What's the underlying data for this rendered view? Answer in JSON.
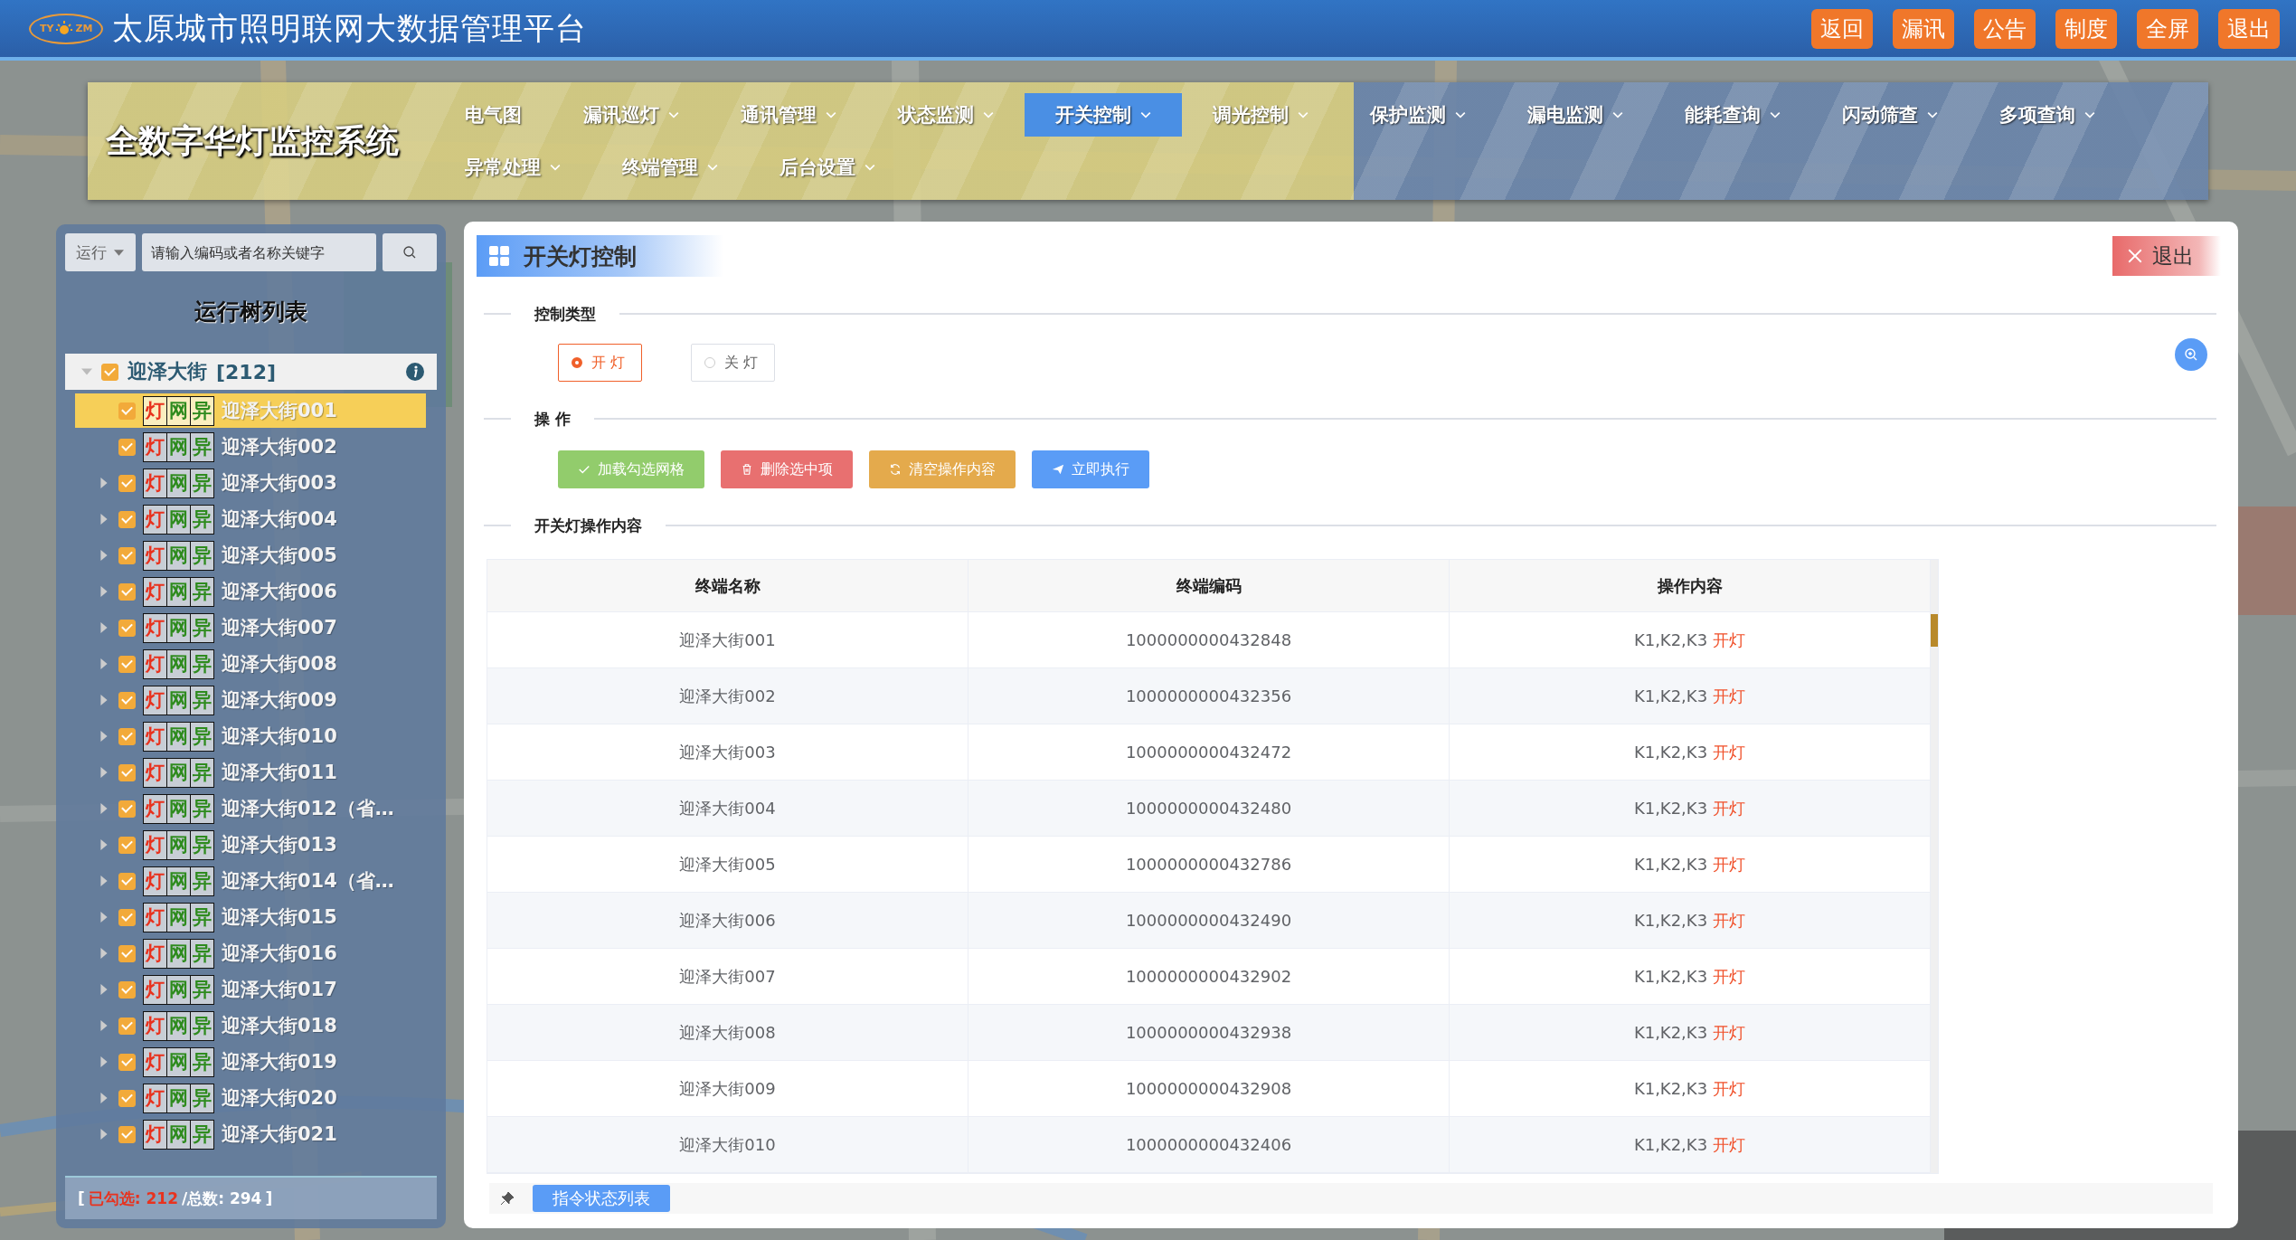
{
  "header": {
    "logo": {
      "left": "TY",
      "right": "ZM"
    },
    "title": "太原城市照明联网大数据管理平台",
    "buttons": [
      "返回",
      "漏讯",
      "公告",
      "制度",
      "全屏",
      "退出"
    ]
  },
  "nav": {
    "title": "全数字华灯监控系统",
    "rows": [
      [
        {
          "label": "电气图",
          "has_menu": false,
          "selected": false
        },
        {
          "label": "漏讯巡灯",
          "has_menu": true,
          "selected": false
        },
        {
          "label": "通讯管理",
          "has_menu": true,
          "selected": false
        },
        {
          "label": "状态监测",
          "has_menu": true,
          "selected": false
        },
        {
          "label": "开关控制",
          "has_menu": true,
          "selected": true
        },
        {
          "label": "调光控制",
          "has_menu": true,
          "selected": false
        },
        {
          "label": "保护监测",
          "has_menu": true,
          "selected": false
        },
        {
          "label": "漏电监测",
          "has_menu": true,
          "selected": false
        },
        {
          "label": "能耗查询",
          "has_menu": true,
          "selected": false
        },
        {
          "label": "闪动筛查",
          "has_menu": true,
          "selected": false
        },
        {
          "label": "多项查询",
          "has_menu": true,
          "selected": false
        }
      ],
      [
        {
          "label": "异常处理",
          "has_menu": true,
          "selected": false
        },
        {
          "label": "终端管理",
          "has_menu": true,
          "selected": false
        },
        {
          "label": "后台设置",
          "has_menu": true,
          "selected": false
        }
      ]
    ]
  },
  "sidebar": {
    "filter": "运行",
    "search": {
      "placeholder": "请输入编码或者名称关键字"
    },
    "title": "运行树列表",
    "tree": {
      "label": "迎泽大街",
      "count": "[212]",
      "checked": true,
      "expanded": true,
      "children": [
        {
          "label": "迎泽大街001",
          "checked": true,
          "selected": true,
          "expandable": false,
          "tags": [
            {
              "text": "灯",
              "color": "#e8321e"
            },
            {
              "text": "网",
              "color": "#2e8b1e"
            },
            {
              "text": "异",
              "color": "#2e8b1e"
            }
          ]
        },
        {
          "label": "迎泽大街002",
          "checked": true,
          "selected": false,
          "expandable": false,
          "tags": [
            {
              "text": "灯",
              "color": "#e8321e"
            },
            {
              "text": "网",
              "color": "#2e8b1e"
            },
            {
              "text": "异",
              "color": "#2e8b1e"
            }
          ]
        },
        {
          "label": "迎泽大街003",
          "checked": true,
          "selected": false,
          "expandable": true,
          "tags": [
            {
              "text": "灯",
              "color": "#e8321e"
            },
            {
              "text": "网",
              "color": "#2e8b1e"
            },
            {
              "text": "异",
              "color": "#2e8b1e"
            }
          ]
        },
        {
          "label": "迎泽大街004",
          "checked": true,
          "selected": false,
          "expandable": true,
          "tags": [
            {
              "text": "灯",
              "color": "#e8321e"
            },
            {
              "text": "网",
              "color": "#2e8b1e"
            },
            {
              "text": "异",
              "color": "#2e8b1e"
            }
          ]
        },
        {
          "label": "迎泽大街005",
          "checked": true,
          "selected": false,
          "expandable": true,
          "tags": [
            {
              "text": "灯",
              "color": "#e8321e"
            },
            {
              "text": "网",
              "color": "#2e8b1e"
            },
            {
              "text": "异",
              "color": "#2e8b1e"
            }
          ]
        },
        {
          "label": "迎泽大街006",
          "checked": true,
          "selected": false,
          "expandable": true,
          "tags": [
            {
              "text": "灯",
              "color": "#e8321e"
            },
            {
              "text": "网",
              "color": "#2e8b1e"
            },
            {
              "text": "异",
              "color": "#2e8b1e"
            }
          ]
        },
        {
          "label": "迎泽大街007",
          "checked": true,
          "selected": false,
          "expandable": true,
          "tags": [
            {
              "text": "灯",
              "color": "#e8321e"
            },
            {
              "text": "网",
              "color": "#2e8b1e"
            },
            {
              "text": "异",
              "color": "#2e8b1e"
            }
          ]
        },
        {
          "label": "迎泽大街008",
          "checked": true,
          "selected": false,
          "expandable": true,
          "tags": [
            {
              "text": "灯",
              "color": "#e8321e"
            },
            {
              "text": "网",
              "color": "#2e8b1e"
            },
            {
              "text": "异",
              "color": "#2e8b1e"
            }
          ]
        },
        {
          "label": "迎泽大街009",
          "checked": true,
          "selected": false,
          "expandable": true,
          "tags": [
            {
              "text": "灯",
              "color": "#e8321e"
            },
            {
              "text": "网",
              "color": "#2e8b1e"
            },
            {
              "text": "异",
              "color": "#2e8b1e"
            }
          ]
        },
        {
          "label": "迎泽大街010",
          "checked": true,
          "selected": false,
          "expandable": true,
          "tags": [
            {
              "text": "灯",
              "color": "#e8321e"
            },
            {
              "text": "网",
              "color": "#2e8b1e"
            },
            {
              "text": "异",
              "color": "#2e8b1e"
            }
          ]
        },
        {
          "label": "迎泽大街011",
          "checked": true,
          "selected": false,
          "expandable": true,
          "tags": [
            {
              "text": "灯",
              "color": "#e8321e"
            },
            {
              "text": "网",
              "color": "#2e8b1e"
            },
            {
              "text": "异",
              "color": "#2e8b1e"
            }
          ]
        },
        {
          "label": "迎泽大街012（省…",
          "checked": true,
          "selected": false,
          "expandable": true,
          "tags": [
            {
              "text": "灯",
              "color": "#e8321e"
            },
            {
              "text": "网",
              "color": "#2e8b1e"
            },
            {
              "text": "异",
              "color": "#2e8b1e"
            }
          ]
        },
        {
          "label": "迎泽大街013",
          "checked": true,
          "selected": false,
          "expandable": true,
          "tags": [
            {
              "text": "灯",
              "color": "#e8321e"
            },
            {
              "text": "网",
              "color": "#2e8b1e"
            },
            {
              "text": "异",
              "color": "#2e8b1e"
            }
          ]
        },
        {
          "label": "迎泽大街014（省…",
          "checked": true,
          "selected": false,
          "expandable": true,
          "tags": [
            {
              "text": "灯",
              "color": "#e8321e"
            },
            {
              "text": "网",
              "color": "#2e8b1e"
            },
            {
              "text": "异",
              "color": "#2e8b1e"
            }
          ]
        },
        {
          "label": "迎泽大街015",
          "checked": true,
          "selected": false,
          "expandable": true,
          "tags": [
            {
              "text": "灯",
              "color": "#e8321e"
            },
            {
              "text": "网",
              "color": "#2e8b1e"
            },
            {
              "text": "异",
              "color": "#2e8b1e"
            }
          ]
        },
        {
          "label": "迎泽大街016",
          "checked": true,
          "selected": false,
          "expandable": true,
          "tags": [
            {
              "text": "灯",
              "color": "#e8321e"
            },
            {
              "text": "网",
              "color": "#2e8b1e"
            },
            {
              "text": "异",
              "color": "#2e8b1e"
            }
          ]
        },
        {
          "label": "迎泽大街017",
          "checked": true,
          "selected": false,
          "expandable": true,
          "tags": [
            {
              "text": "灯",
              "color": "#e8321e"
            },
            {
              "text": "网",
              "color": "#2e8b1e"
            },
            {
              "text": "异",
              "color": "#2e8b1e"
            }
          ]
        },
        {
          "label": "迎泽大街018",
          "checked": true,
          "selected": false,
          "expandable": true,
          "tags": [
            {
              "text": "灯",
              "color": "#e8321e"
            },
            {
              "text": "网",
              "color": "#2e8b1e"
            },
            {
              "text": "异",
              "color": "#2e8b1e"
            }
          ]
        },
        {
          "label": "迎泽大街019",
          "checked": true,
          "selected": false,
          "expandable": true,
          "tags": [
            {
              "text": "灯",
              "color": "#e8321e"
            },
            {
              "text": "网",
              "color": "#2e8b1e"
            },
            {
              "text": "异",
              "color": "#2e8b1e"
            }
          ]
        },
        {
          "label": "迎泽大街020",
          "checked": true,
          "selected": false,
          "expandable": true,
          "tags": [
            {
              "text": "灯",
              "color": "#e8321e"
            },
            {
              "text": "网",
              "color": "#2e8b1e"
            },
            {
              "text": "异",
              "color": "#2e8b1e"
            }
          ]
        },
        {
          "label": "迎泽大街021",
          "checked": true,
          "selected": false,
          "expandable": true,
          "tags": [
            {
              "text": "灯",
              "color": "#e8321e"
            },
            {
              "text": "网",
              "color": "#2e8b1e"
            },
            {
              "text": "异",
              "color": "#2e8b1e"
            }
          ]
        }
      ]
    },
    "footer": {
      "open": "[",
      "selected_count": "已勾选: 212",
      "total": "/总数: 294",
      "close": "]"
    }
  },
  "dialog": {
    "title": "开关灯控制",
    "close_button": "退出",
    "control_type": {
      "heading": "控制类型",
      "options": [
        {
          "label": "开 灯",
          "selected": true
        },
        {
          "label": "关 灯",
          "selected": false
        }
      ]
    },
    "operation": {
      "heading": "操 作",
      "buttons": [
        {
          "label": "加载勾选网格",
          "kind": "success"
        },
        {
          "label": "删除选中项",
          "kind": "danger"
        },
        {
          "label": "清空操作内容",
          "kind": "warning"
        },
        {
          "label": "立即执行",
          "kind": "primary"
        }
      ]
    },
    "content_heading": "开关灯操作内容",
    "table": {
      "columns": [
        "终端名称",
        "终端编码",
        "操作内容"
      ],
      "rows": [
        {
          "name": "迎泽大街001",
          "code": "1000000000432848",
          "switches": "K1,K2,K3",
          "action": "开灯"
        },
        {
          "name": "迎泽大街002",
          "code": "1000000000432356",
          "switches": "K1,K2,K3",
          "action": "开灯"
        },
        {
          "name": "迎泽大街003",
          "code": "1000000000432472",
          "switches": "K1,K2,K3",
          "action": "开灯"
        },
        {
          "name": "迎泽大街004",
          "code": "1000000000432480",
          "switches": "K1,K2,K3",
          "action": "开灯"
        },
        {
          "name": "迎泽大街005",
          "code": "1000000000432786",
          "switches": "K1,K2,K3",
          "action": "开灯"
        },
        {
          "name": "迎泽大街006",
          "code": "1000000000432490",
          "switches": "K1,K2,K3",
          "action": "开灯"
        },
        {
          "name": "迎泽大街007",
          "code": "1000000000432902",
          "switches": "K1,K2,K3",
          "action": "开灯"
        },
        {
          "name": "迎泽大街008",
          "code": "1000000000432938",
          "switches": "K1,K2,K3",
          "action": "开灯"
        },
        {
          "name": "迎泽大街009",
          "code": "1000000000432908",
          "switches": "K1,K2,K3",
          "action": "开灯"
        },
        {
          "name": "迎泽大街010",
          "code": "1000000000432406",
          "switches": "K1,K2,K3",
          "action": "开灯"
        }
      ]
    },
    "bottom_tab": "指令状态列表"
  }
}
